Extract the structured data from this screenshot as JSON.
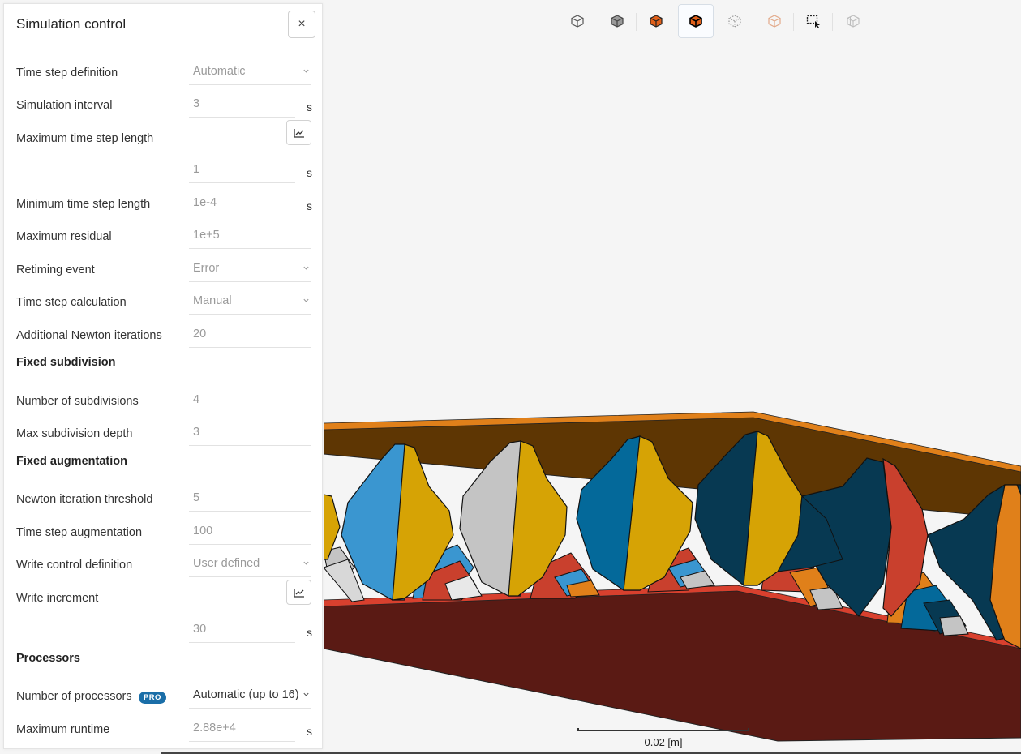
{
  "panel": {
    "title": "Simulation control",
    "close_label": "×",
    "rows": {
      "time_step_definition": {
        "label": "Time step definition",
        "value": "Automatic"
      },
      "simulation_interval": {
        "label": "Simulation interval",
        "value": "3",
        "unit": "s"
      },
      "maximum_time_step_length": {
        "label": "Maximum time step length",
        "value": "1",
        "unit": "s"
      },
      "minimum_time_step_length": {
        "label": "Minimum time step length",
        "value": "1e-4",
        "unit": "s"
      },
      "maximum_residual": {
        "label": "Maximum residual",
        "value": "1e+5"
      },
      "retiming_event": {
        "label": "Retiming event",
        "value": "Error"
      },
      "time_step_calculation": {
        "label": "Time step calculation",
        "value": "Manual"
      },
      "additional_newton_iterations": {
        "label": "Additional Newton iterations",
        "value": "20"
      },
      "fixed_subdivision": {
        "label": "Fixed subdivision"
      },
      "number_of_subdivisions": {
        "label": "Number of subdivisions",
        "value": "4"
      },
      "max_subdivision_depth": {
        "label": "Max subdivision depth",
        "value": "3"
      },
      "fixed_augmentation": {
        "label": "Fixed augmentation"
      },
      "newton_iteration_threshold": {
        "label": "Newton iteration threshold",
        "value": "5"
      },
      "time_step_augmentation": {
        "label": "Time step augmentation",
        "value": "100"
      },
      "write_control_definition": {
        "label": "Write control definition",
        "value": "User defined"
      },
      "write_increment": {
        "label": "Write increment",
        "value": "30",
        "unit": "s"
      },
      "processors": {
        "label": "Processors"
      },
      "number_of_processors": {
        "label": "Number of processors",
        "badge": "PRO",
        "value": "Automatic (up to 16)"
      },
      "maximum_runtime": {
        "label": "Maximum runtime",
        "value": "2.88e+4",
        "unit": "s"
      }
    }
  },
  "toolbar": {
    "icons": [
      "wireframe-cube-icon",
      "solid-cube-icon",
      "orange-cube-icon",
      "orange-cube-edges-icon",
      "dotted-cube-icon",
      "faded-cube-icon",
      "box-select-icon",
      "disabled-cube-icon"
    ],
    "active_index": 3
  },
  "viewport": {
    "scale_label": "0.02 [m]"
  },
  "colors": {
    "accent": "#1a6ea8",
    "orange": "#e0801a",
    "brown_top": "#5e3603",
    "brown_bottom": "#5a1a14",
    "red_edge": "#d8402e",
    "gold": "#d6a305",
    "light_blue": "#3a96d0",
    "mid_blue": "#04699a",
    "navy": "#073952",
    "grey": "#c4c4c4",
    "red": "#c9402d"
  }
}
